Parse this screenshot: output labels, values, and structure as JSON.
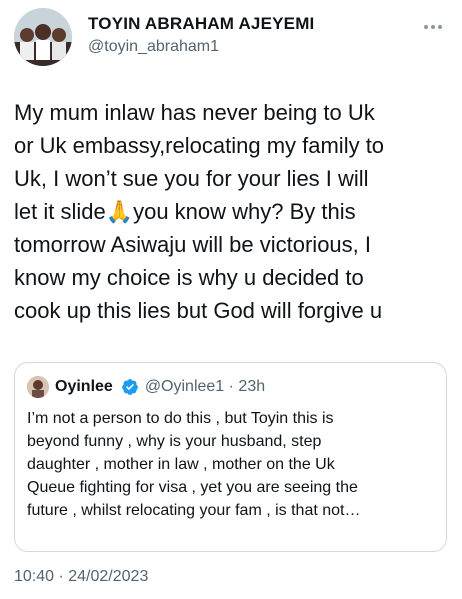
{
  "author": {
    "display_name": "TOYIN ABRAHAM AJEYEMI",
    "handle": "@toyin_abraham1"
  },
  "tweet": {
    "text": "My mum inlaw has never being to Uk\nor Uk embassy,relocating my family to\nUk, I won’t sue you for your lies I will\nlet it slide🙏you know why? By this\ntomorrow Asiwaju will be victorious, I\nknow my choice is why u decided to\ncook up this lies but God will forgive u",
    "timestamp": "10:40 · 24/02/2023"
  },
  "quoted": {
    "display_name": "Oyinlee",
    "meta": "@Oyinlee1 · 23h",
    "text": "I’m not a person to do this , but Toyin this is\nbeyond funny , why is your husband, step\ndaughter , mother in law , mother  on the Uk\nQueue fighting for visa , yet you are seeing the\nfuture , whilst relocating your fam , is that not…"
  },
  "icons": {
    "more": "more-icon",
    "verified": "verified-badge-icon"
  },
  "colors": {
    "text": "#0f1419",
    "secondary": "#536471",
    "verified": "#1d9bf0",
    "border": "#cfd9de"
  }
}
